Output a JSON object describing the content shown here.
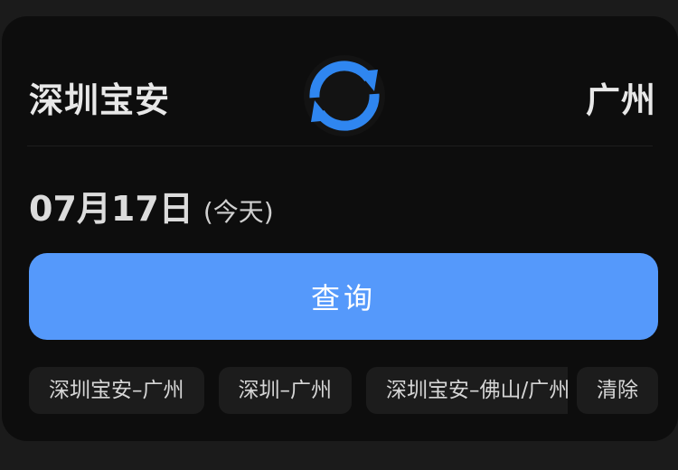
{
  "route": {
    "from_station": "深圳宝安",
    "to_station": "广州",
    "swap_icon": "swap-arrows-icon"
  },
  "date": {
    "main": "07月17日",
    "sub": "(今天)"
  },
  "query_button": {
    "label": "查询",
    "color": "#5599fb"
  },
  "history": {
    "items": [
      {
        "label": "深圳宝安–广州"
      },
      {
        "label": "深圳–广州"
      },
      {
        "label": "深圳宝安–佛山/广州"
      }
    ],
    "clear_label": "清除"
  },
  "colors": {
    "background": "#1b1b1b",
    "card": "#0d0d0d",
    "icon_blue": "#2f86f0"
  }
}
